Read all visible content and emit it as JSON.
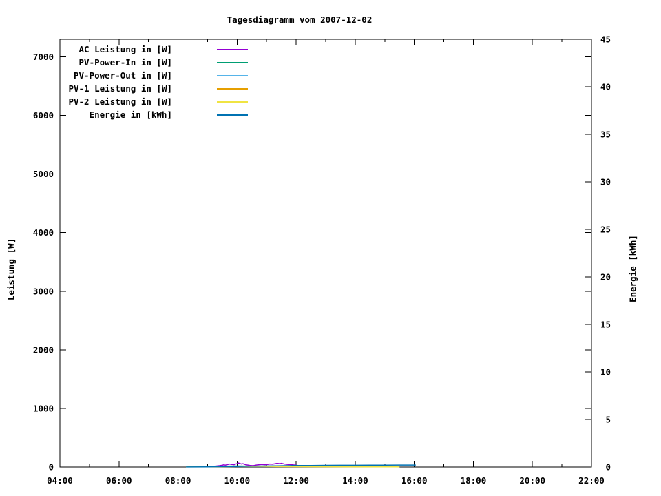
{
  "chart": {
    "title": "Tagesdiagramm vom 2007-12-02",
    "y1_axis_title": "Leistung [W]",
    "y2_axis_title": "Energie [kWh]"
  },
  "chart_data": {
    "type": "line",
    "title": "Tagesdiagramm vom 2007-12-02",
    "background": "#ffffff",
    "grid": false,
    "legend_position": "top-left-inside",
    "x_axis": {
      "unit": "time of day",
      "range_hours": [
        4,
        22
      ],
      "major_tick_labels": [
        "04:00",
        "06:00",
        "08:00",
        "10:00",
        "12:00",
        "14:00",
        "16:00",
        "18:00",
        "20:00",
        "22:00"
      ],
      "major_tick_hours": [
        4,
        6,
        8,
        10,
        12,
        14,
        16,
        18,
        20,
        22
      ],
      "minor_tick_every_hours": 1
    },
    "y1_axis": {
      "label": "Leistung [W]",
      "range": [
        0,
        7300
      ],
      "ticks": [
        0,
        1000,
        2000,
        3000,
        4000,
        5000,
        6000,
        7000
      ],
      "side": "left",
      "mirrored_on_right": true
    },
    "y2_axis": {
      "label": "Energie [kWh]",
      "range": [
        0,
        45
      ],
      "ticks": [
        0,
        5,
        10,
        15,
        20,
        25,
        30,
        35,
        40,
        45
      ],
      "side": "right"
    },
    "series": [
      {
        "name": "AC Leistung in [W]",
        "color": "#9400d3",
        "axis": "y1",
        "points": [
          [
            8.27,
            6
          ],
          [
            8.4,
            7
          ],
          [
            8.55,
            8
          ],
          [
            8.7,
            8
          ],
          [
            8.85,
            9
          ],
          [
            9.0,
            10
          ],
          [
            9.1,
            11
          ],
          [
            9.2,
            13
          ],
          [
            9.3,
            18
          ],
          [
            9.4,
            24
          ],
          [
            9.5,
            30
          ],
          [
            9.55,
            38
          ],
          [
            9.6,
            33
          ],
          [
            9.7,
            45
          ],
          [
            9.75,
            52
          ],
          [
            9.8,
            46
          ],
          [
            9.9,
            40
          ],
          [
            9.95,
            50
          ],
          [
            10.0,
            58
          ],
          [
            10.05,
            68
          ],
          [
            10.1,
            60
          ],
          [
            10.15,
            52
          ],
          [
            10.2,
            56
          ],
          [
            10.3,
            38
          ],
          [
            10.4,
            30
          ],
          [
            10.45,
            26
          ],
          [
            10.55,
            24
          ],
          [
            10.65,
            34
          ],
          [
            10.75,
            40
          ],
          [
            10.85,
            44
          ],
          [
            10.95,
            40
          ],
          [
            11.05,
            46
          ],
          [
            11.1,
            52
          ],
          [
            11.2,
            48
          ],
          [
            11.3,
            58
          ],
          [
            11.35,
            64
          ],
          [
            11.45,
            58
          ],
          [
            11.5,
            62
          ],
          [
            11.6,
            52
          ],
          [
            11.7,
            46
          ],
          [
            11.8,
            42
          ],
          [
            11.9,
            36
          ],
          [
            12.0,
            30
          ],
          [
            12.1,
            24
          ],
          [
            12.2,
            18
          ],
          [
            12.3,
            14
          ],
          [
            12.45,
            12
          ],
          [
            12.6,
            14
          ],
          [
            12.75,
            16
          ],
          [
            12.9,
            12
          ],
          [
            13.05,
            15
          ],
          [
            13.2,
            12
          ],
          [
            13.35,
            14
          ],
          [
            13.5,
            12
          ],
          [
            13.65,
            13
          ],
          [
            13.8,
            11
          ],
          [
            14.0,
            12
          ],
          [
            14.2,
            10
          ],
          [
            14.4,
            9
          ],
          [
            14.6,
            8
          ],
          [
            14.8,
            7
          ],
          [
            15.0,
            6
          ],
          [
            15.25,
            5
          ]
        ]
      },
      {
        "name": "PV-Power-In in [W]",
        "color": "#009e73",
        "axis": "y1",
        "points": [
          [
            8.27,
            10
          ],
          [
            8.6,
            11
          ],
          [
            9.0,
            12
          ],
          [
            9.5,
            14
          ],
          [
            10.0,
            18
          ],
          [
            10.5,
            15
          ],
          [
            11.0,
            17
          ],
          [
            11.5,
            19
          ],
          [
            12.0,
            15
          ],
          [
            12.5,
            13
          ],
          [
            13.0,
            12
          ],
          [
            13.5,
            12
          ],
          [
            14.0,
            11
          ],
          [
            14.5,
            10
          ],
          [
            15.0,
            9
          ],
          [
            15.5,
            8
          ]
        ]
      },
      {
        "name": "PV-Power-Out in [W]",
        "color": "#56b4e9",
        "axis": "y1",
        "points": [
          [
            8.27,
            8
          ],
          [
            9.0,
            10
          ],
          [
            9.5,
            12
          ],
          [
            10.0,
            15
          ],
          [
            10.5,
            13
          ],
          [
            11.0,
            14
          ],
          [
            11.5,
            16
          ],
          [
            12.0,
            13
          ],
          [
            12.5,
            11
          ],
          [
            13.0,
            10
          ],
          [
            13.5,
            10
          ],
          [
            14.0,
            9
          ],
          [
            14.5,
            8
          ],
          [
            15.0,
            7
          ],
          [
            15.5,
            6
          ]
        ]
      },
      {
        "name": "PV-1 Leistung in [W]",
        "color": "#e69f00",
        "axis": "y1",
        "points": [
          [
            8.27,
            5
          ],
          [
            9.0,
            6
          ],
          [
            10.0,
            9
          ],
          [
            11.0,
            9
          ],
          [
            12.0,
            7
          ],
          [
            13.0,
            6
          ],
          [
            14.0,
            5
          ],
          [
            15.0,
            4
          ],
          [
            15.5,
            4
          ]
        ]
      },
      {
        "name": "PV-2 Leistung in [W]",
        "color": "#f0e442",
        "axis": "y1",
        "points": [
          [
            8.27,
            5
          ],
          [
            9.0,
            6
          ],
          [
            10.0,
            9
          ],
          [
            11.0,
            9
          ],
          [
            12.0,
            7
          ],
          [
            13.0,
            6
          ],
          [
            14.0,
            5
          ],
          [
            15.0,
            4
          ],
          [
            15.5,
            4
          ]
        ]
      },
      {
        "name": "Energie in [kWh]",
        "color": "#0072b2",
        "axis": "y2",
        "points": [
          [
            8.27,
            0.01
          ],
          [
            9.0,
            0.02
          ],
          [
            9.5,
            0.04
          ],
          [
            10.0,
            0.06
          ],
          [
            10.5,
            0.09
          ],
          [
            11.0,
            0.11
          ],
          [
            11.5,
            0.14
          ],
          [
            12.0,
            0.16
          ],
          [
            12.5,
            0.17
          ],
          [
            13.0,
            0.18
          ],
          [
            13.5,
            0.19
          ],
          [
            14.0,
            0.19
          ],
          [
            14.5,
            0.2
          ],
          [
            15.0,
            0.2
          ],
          [
            15.5,
            0.21
          ],
          [
            16.05,
            0.21
          ]
        ]
      }
    ]
  }
}
